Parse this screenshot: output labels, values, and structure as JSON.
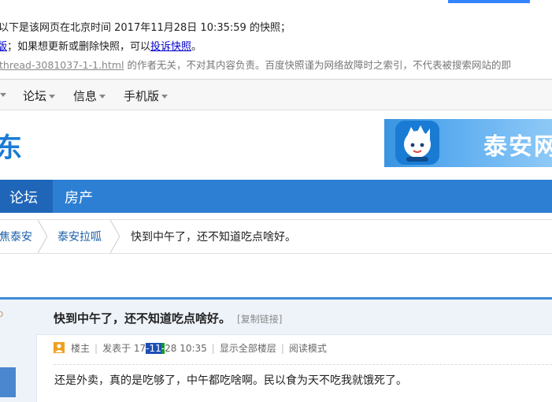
{
  "snapshot": {
    "line1": "以下是该网页在北京时间 2017年11月28日 10:35:59 的快照；",
    "line2_prefix": "版",
    "line2_text": "；如果想更新或删除快照，可以",
    "line2_link": "投诉快照",
    "line2_end": "。",
    "url": "thread-3081037-1-1.html",
    "url_rest": " 的作者无关，不对其内容负责。百度快照谨为网络故障时之索引，不代表被搜索网站的即"
  },
  "topnav": {
    "items": [
      "论坛",
      "信息",
      "手机版"
    ]
  },
  "header": {
    "logo_fragment": "东",
    "banner_text": "泰安网"
  },
  "bluenav": {
    "items": [
      "论坛",
      "房产"
    ]
  },
  "breadcrumb": {
    "items": [
      "焦泰安",
      "泰安拉呱"
    ],
    "current": "快到中午了，还不知道吃点啥好。"
  },
  "post": {
    "title": "快到中午了，还不知道吃点啥好。",
    "copy_link": "[复制链接]",
    "author_label": "楼主",
    "posted_prefix": "发表于 17",
    "posted_hl1": "-11",
    "posted_hl2": "-",
    "posted_suffix": "28 10:35",
    "show_all": "显示全部楼层",
    "read_mode": "阅读模式",
    "content": "还是外卖，真的是吃够了，中午都吃啥啊。民以食为天不吃我就饿死了。"
  },
  "colors": {
    "accent_blue": "#2d7fd3",
    "link_blue": "#1a5fa8"
  }
}
